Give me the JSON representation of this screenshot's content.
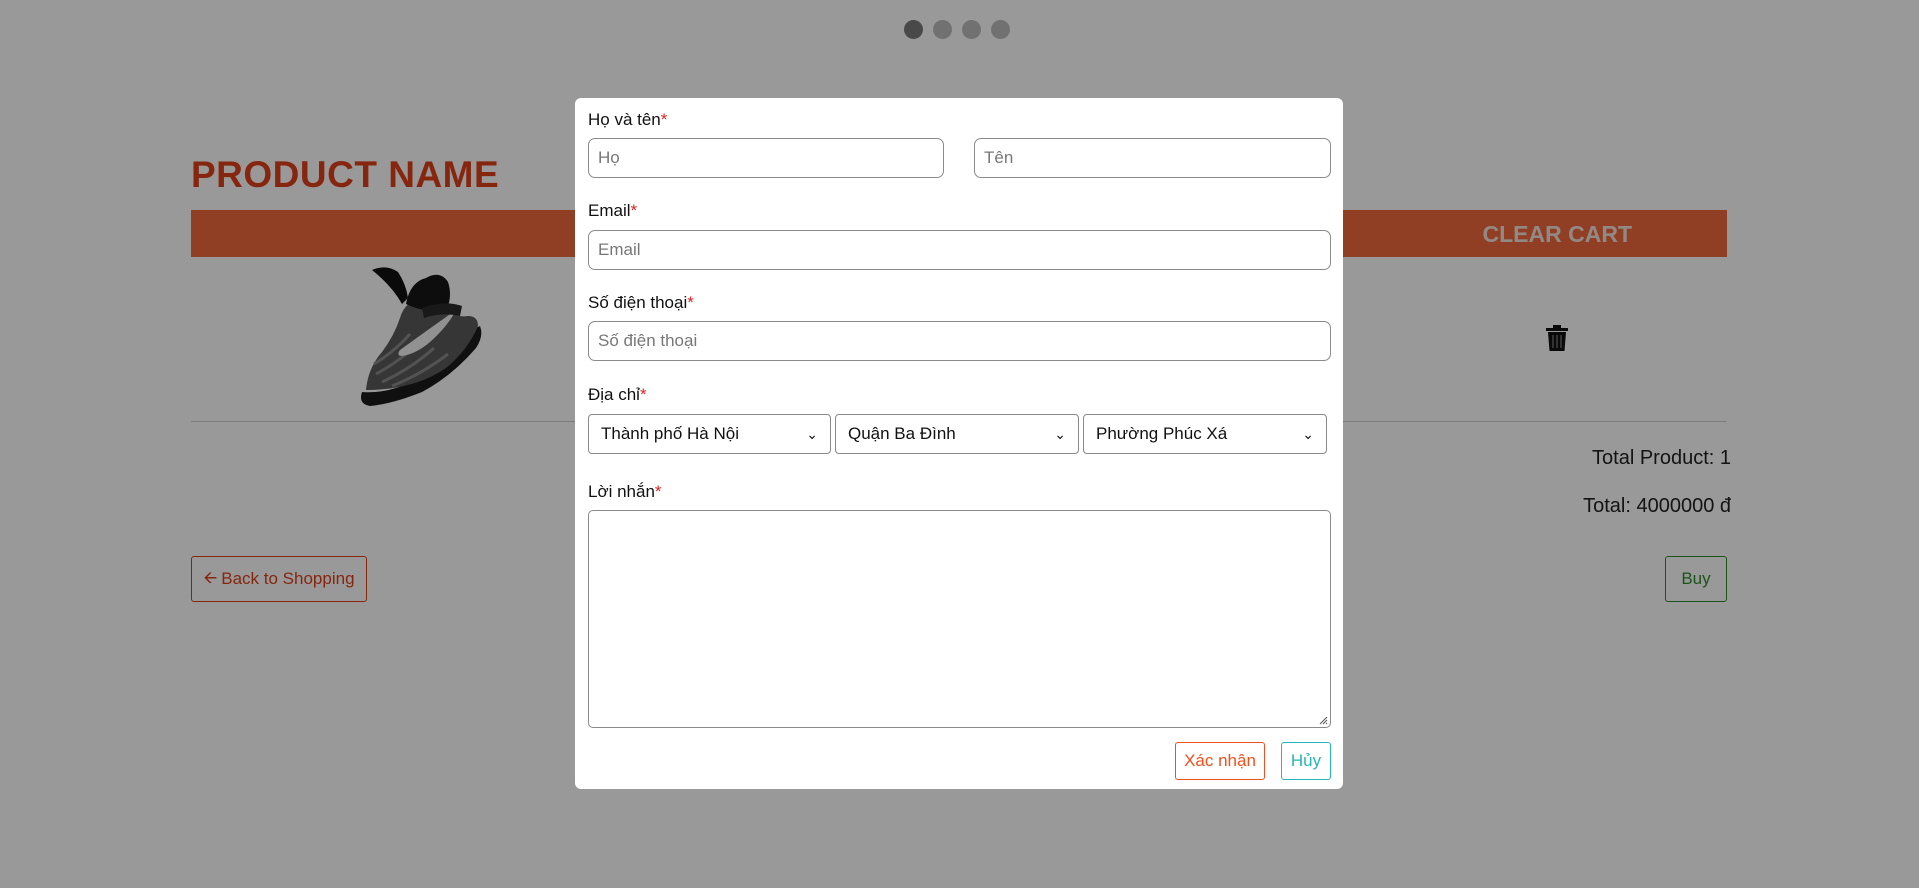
{
  "carousel": {
    "dot_count": 4,
    "active_index": 0
  },
  "cart": {
    "product_title": "PRODUCT NAME",
    "clear_cart_label": "CLEAR CART",
    "item_image_icon": "sneaker-image",
    "delete_icon": "trash-icon",
    "total_product_label": "Total Product: 1",
    "total_price_label": "Total: 4000000 đ",
    "back_label": "Back to Shopping",
    "buy_label": "Buy"
  },
  "colors": {
    "accent": "#e0401a",
    "bar": "#f26a3d",
    "buy": "#2e8b2e",
    "confirm": "#f0501e",
    "cancel": "#27b6b6",
    "required": "#e02020"
  },
  "form": {
    "name": {
      "label": "Họ và tên",
      "required_mark": "*",
      "last_placeholder": "Họ",
      "first_placeholder": "Tên",
      "last_value": "",
      "first_value": ""
    },
    "email": {
      "label": "Email",
      "required_mark": "*",
      "placeholder": "Email",
      "value": ""
    },
    "phone": {
      "label": "Số điện thoại",
      "required_mark": "*",
      "placeholder": "Số điện thoại",
      "value": ""
    },
    "address": {
      "label": "Địa chỉ",
      "required_mark": "*",
      "city": "Thành phố Hà Nội",
      "district": "Quận Ba Đình",
      "ward": "Phường Phúc Xá"
    },
    "message": {
      "label": "Lời nhắn",
      "required_mark": "*",
      "value": ""
    },
    "confirm_label": "Xác nhận",
    "cancel_label": "Hủy"
  }
}
